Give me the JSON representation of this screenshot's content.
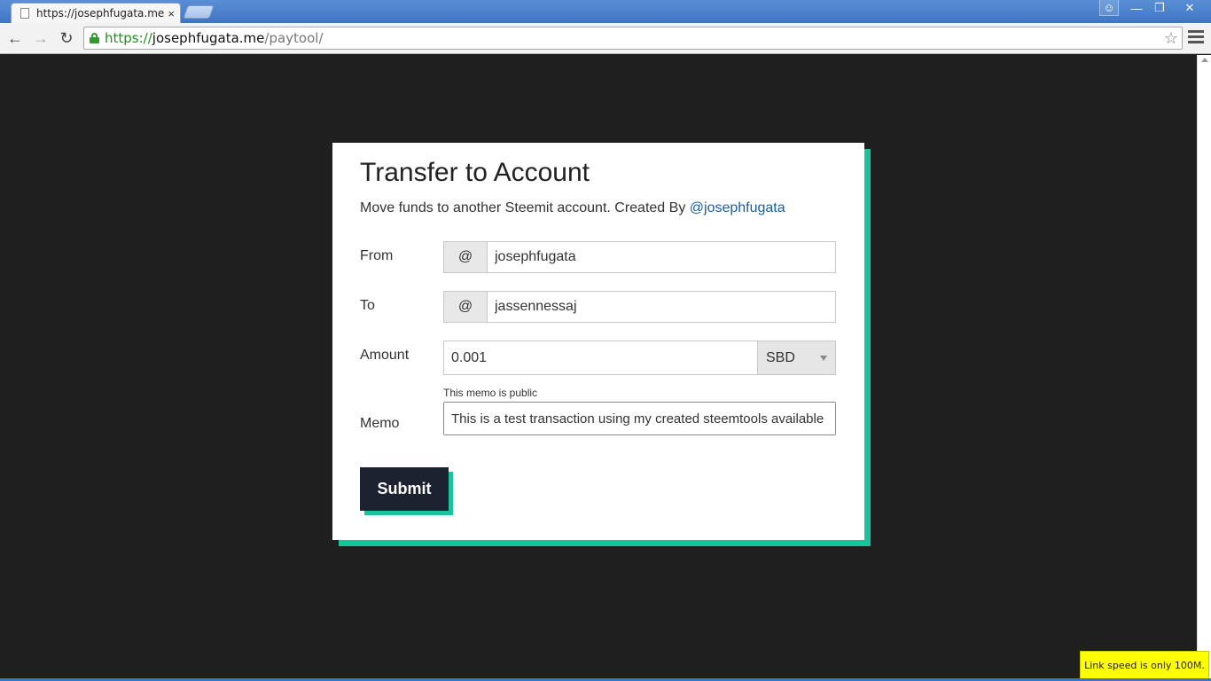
{
  "browser": {
    "tab_title": "https://josephfugata.me/paytool/",
    "tab_close": "×",
    "url_scheme": "https://",
    "url_host": "josephfugata.me",
    "url_path": "/paytool/"
  },
  "form": {
    "title": "Transfer to Account",
    "subtitle": "Move funds to another Steemit account. Created By ",
    "author_link": "@josephfugata",
    "from_label": "From",
    "from_prefix": "@",
    "from_value": "josephfugata",
    "to_label": "To",
    "to_prefix": "@",
    "to_value": "jassennessaj",
    "amount_label": "Amount",
    "amount_value": "0.001",
    "currency": "SBD",
    "memo_hint": "This memo is public",
    "memo_label": "Memo",
    "memo_value": "This is a test transaction using my created steemtools available",
    "submit_label": "Submit"
  },
  "notification": {
    "text": "Link speed is only 100M."
  },
  "colors": {
    "accent": "#1bc39c",
    "button": "#1c2230",
    "page_background": "#1f1f1f",
    "link": "#1a5fa4"
  }
}
